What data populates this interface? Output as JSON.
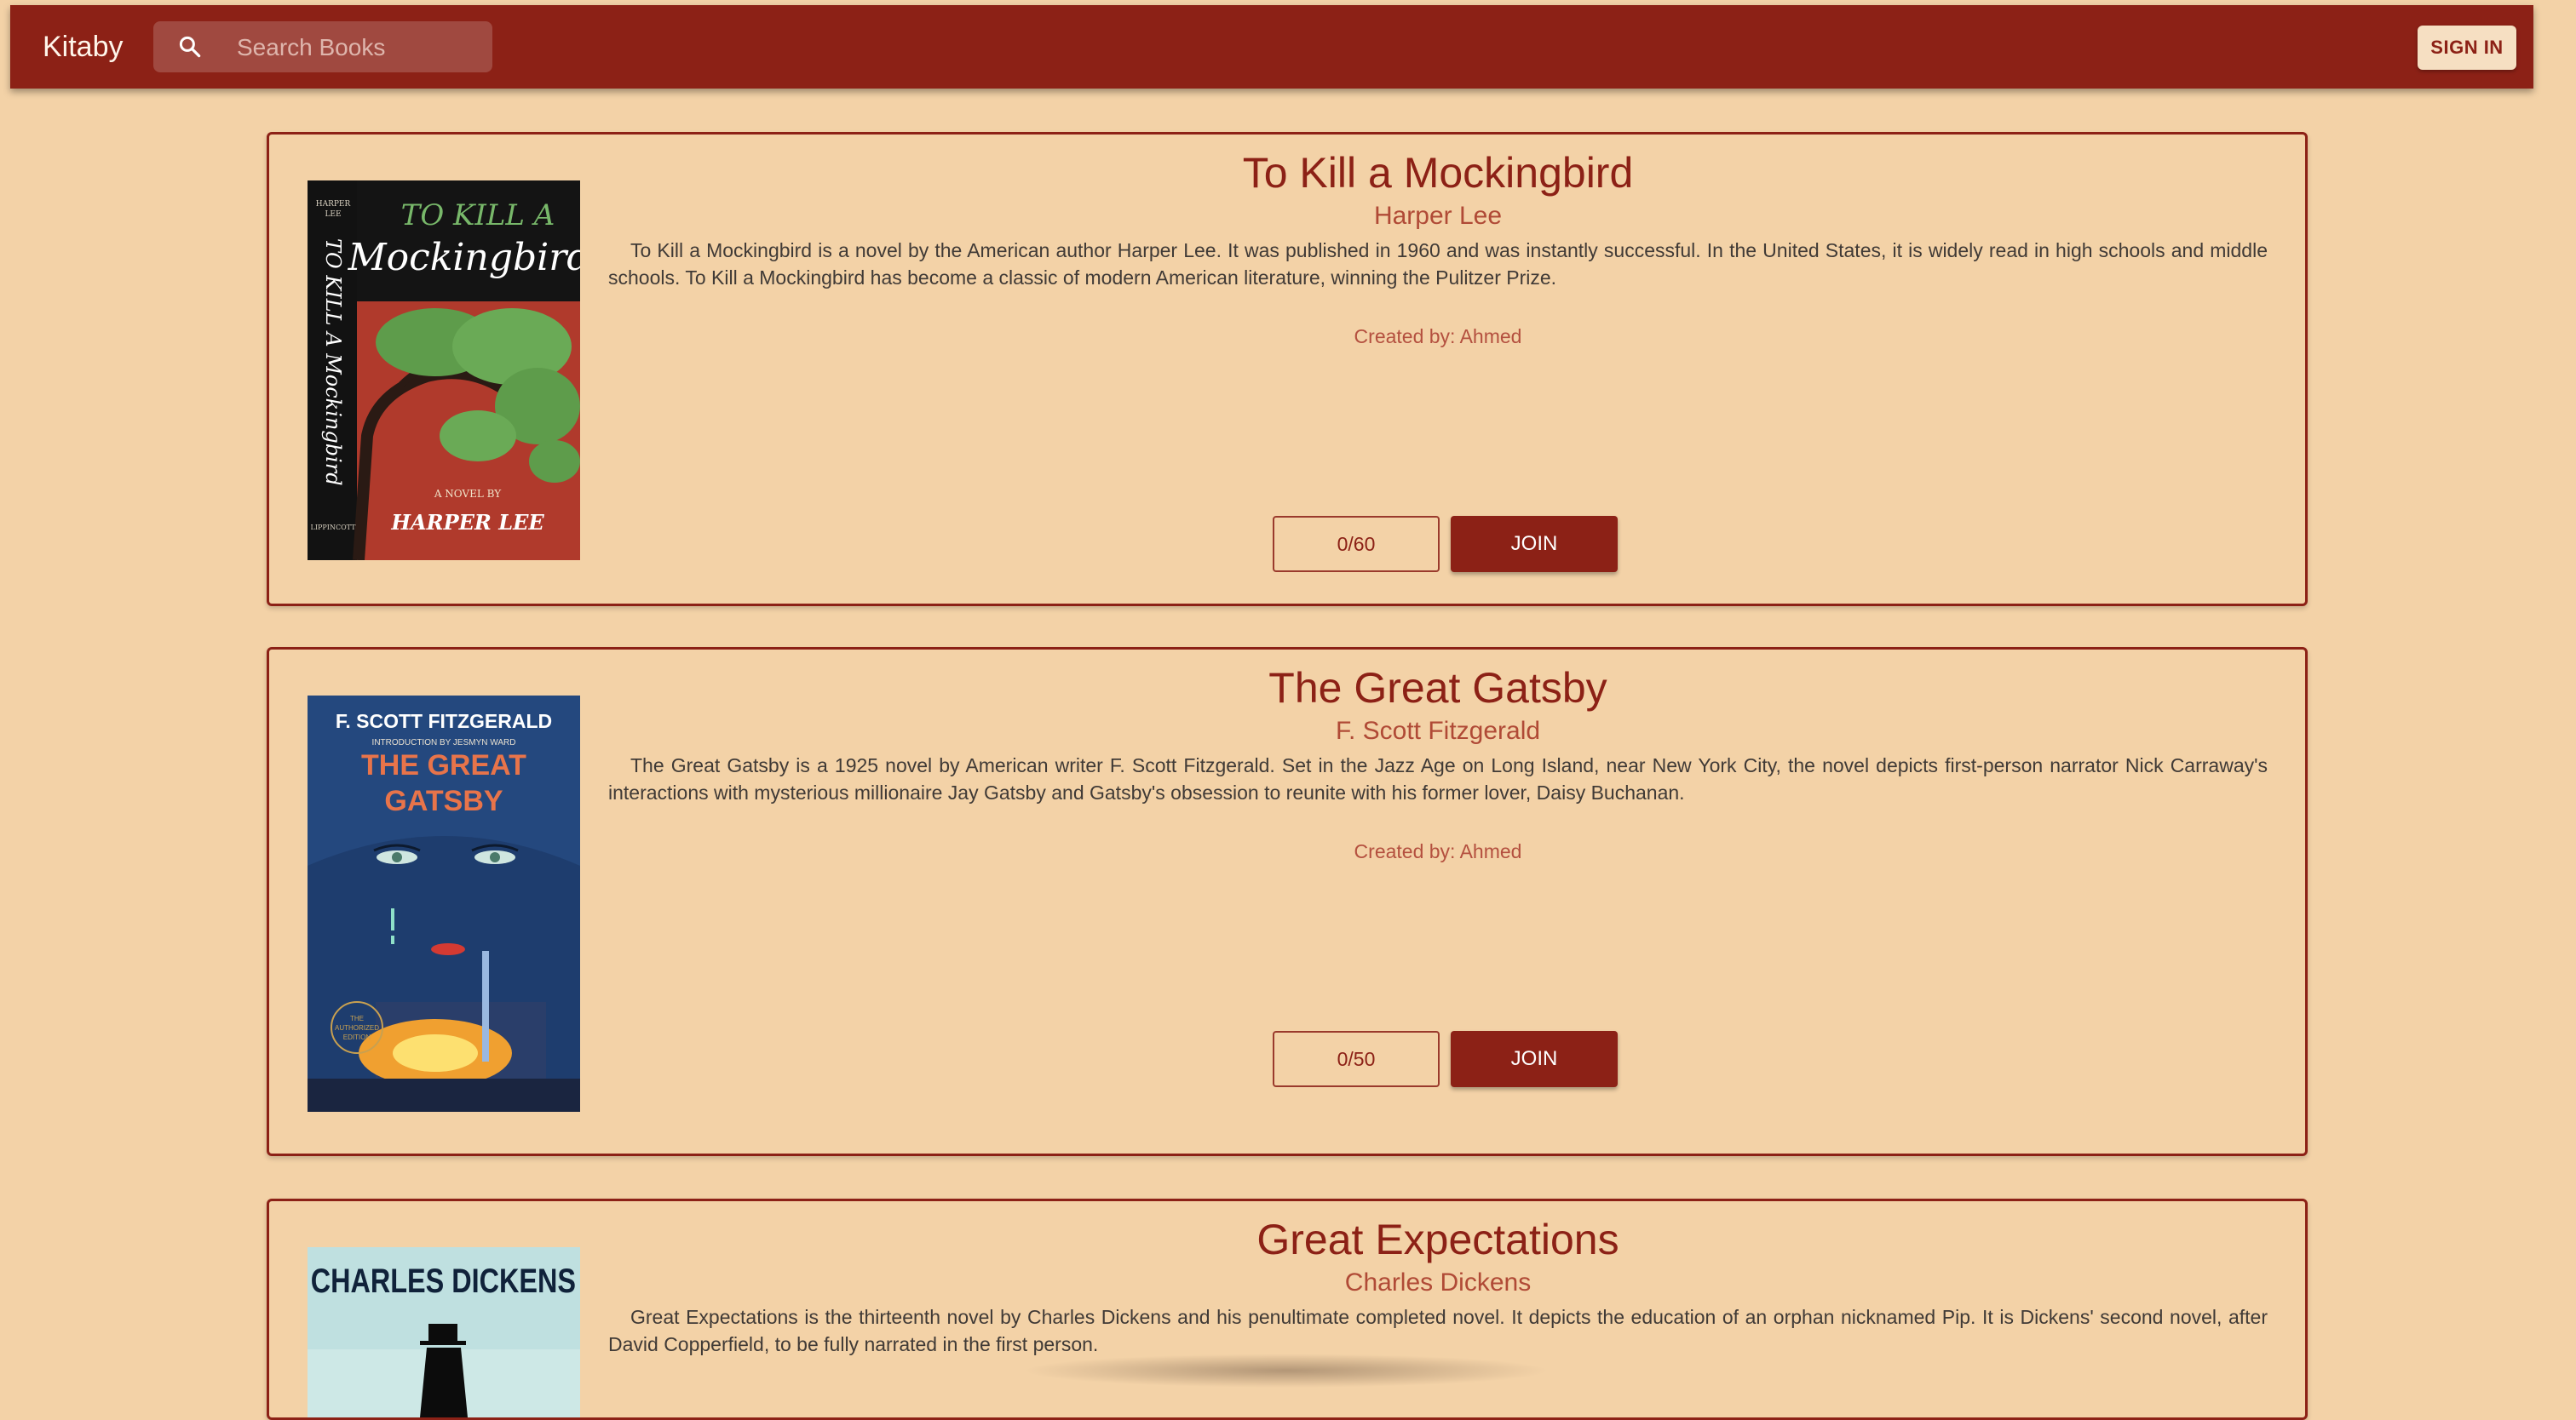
{
  "app": {
    "title": "Kitaby"
  },
  "search": {
    "placeholder": "Search Books"
  },
  "header": {
    "signin_label": "SIGN IN"
  },
  "books": [
    {
      "title": "To Kill a Mockingbird",
      "author": "Harper Lee",
      "description": "To Kill a Mockingbird is a novel by the American author Harper Lee. It was published in 1960 and was instantly successful. In the United States, it is widely read in high schools and middle schools. To Kill a Mockingbird has become a classic of modern American literature, winning the Pulitzer Prize.",
      "created_by": "Created by: Ahmed",
      "count": "0/60",
      "join_label": "JOIN",
      "cover": {
        "line1": "TO KILL A",
        "line2": "Mockingbird",
        "spine": "TO KILL A Mockingbird",
        "small1": "HARPER",
        "small2": "LEE",
        "novelby": "A NOVEL BY",
        "author": "HARPER LEE",
        "publisher": "LIPPINCOTT"
      }
    },
    {
      "title": "The Great Gatsby",
      "author": "F. Scott Fitzgerald",
      "description": "The Great Gatsby is a 1925 novel by American writer F. Scott Fitzgerald. Set in the Jazz Age on Long Island, near New York City, the novel depicts first-person narrator Nick Carraway's interactions with mysterious millionaire Jay Gatsby and Gatsby's obsession to reunite with his former lover, Daisy Buchanan.",
      "created_by": "Created by: Ahmed",
      "count": "0/50",
      "join_label": "JOIN",
      "cover": {
        "author": "F. SCOTT FITZGERALD",
        "intro": "INTRODUCTION BY JESMYN WARD",
        "line1": "THE GREAT",
        "line2": "GATSBY",
        "seal1": "THE",
        "seal2": "AUTHORIZED",
        "seal3": "EDITION"
      }
    },
    {
      "title": "Great Expectations",
      "author": "Charles Dickens",
      "description": "Great Expectations is the thirteenth novel by Charles Dickens and his penultimate completed novel. It depicts the education of an orphan nicknamed Pip. It is Dickens' second novel, after David Copperfield, to be fully narrated in the first person.",
      "cover": {
        "author": "CHARLES DICKENS"
      }
    }
  ]
}
